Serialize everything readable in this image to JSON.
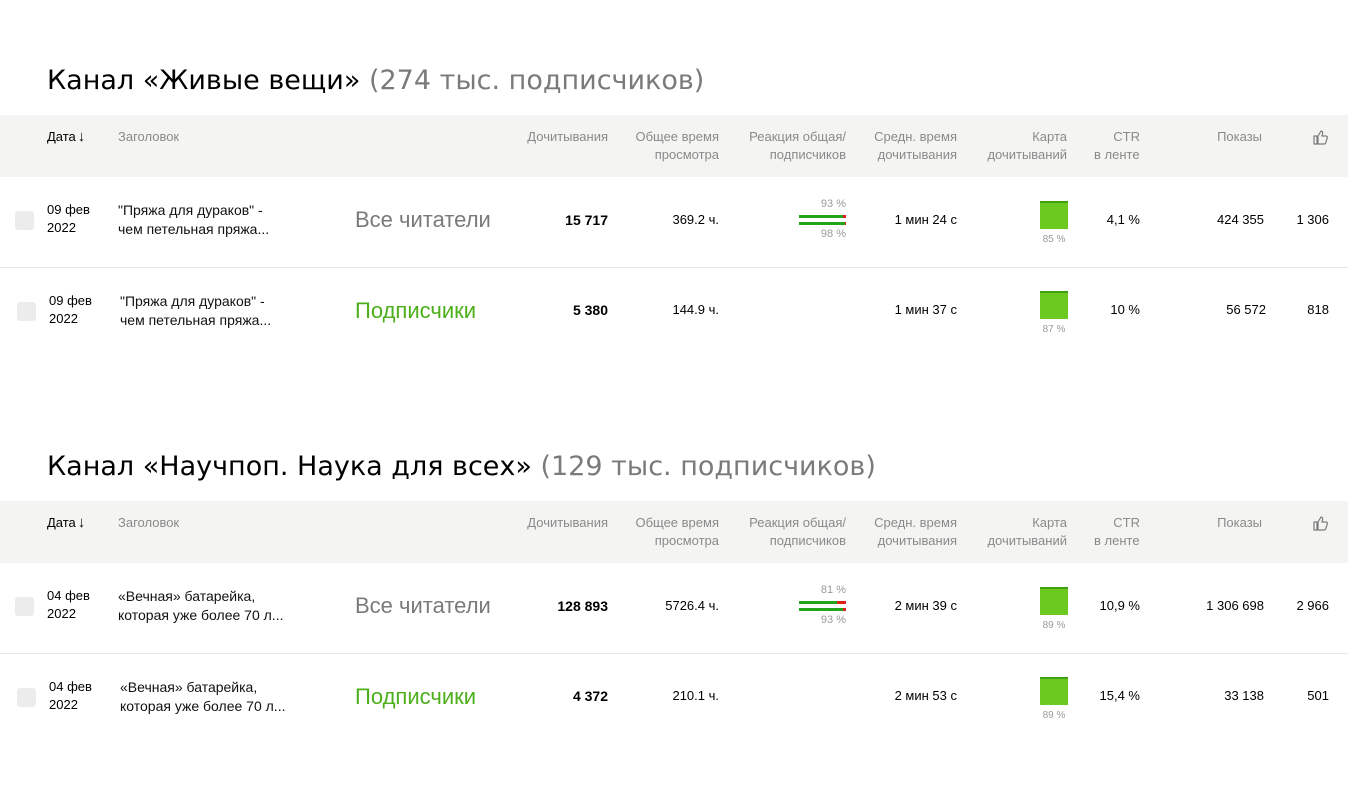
{
  "columns": {
    "date": "Дата",
    "date_sort_icon": "arrow-down-icon",
    "title": "Заголовок",
    "reads": "Дочитывания",
    "total_time_1": "Общее время",
    "total_time_2": "просмотра",
    "reaction_1": "Реакция общая/",
    "reaction_2": "подписчиков",
    "avg_time_1": "Средн. время",
    "avg_time_2": "дочитывания",
    "map_1": "Карта",
    "map_2": "дочитываний",
    "ctr_1": "CTR",
    "ctr_2": "в ленте",
    "views": "Показы",
    "likes_icon": "thumbs-up-icon"
  },
  "colors": {
    "accent_green": "#4caf1a",
    "bar_green": "#22a51a",
    "bar_red": "#e0211b",
    "map_green": "#6cc91f",
    "header_bg": "#f4f4f2"
  },
  "channels": [
    {
      "name": "Канал «Живые вещи»",
      "subscribers": "(274 тыс. подписчиков)",
      "rows": [
        {
          "date_1": "09 фев",
          "date_2": "2022",
          "title_1": "\"Пряжа для дураков\" -",
          "title_2": "чем петельная пряжа...",
          "audience": "Все читатели",
          "reads": "15 717",
          "total_time": "369.2 ч.",
          "reaction_top": "93 %",
          "reaction_bottom": "98 %",
          "reaction_top_value": 0.93,
          "reaction_bottom_value": 0.98,
          "avg_time": "1 мин 24 с",
          "map_pct": "85 %",
          "ctr": "4,1 %",
          "views": "424 355",
          "likes": "1 306"
        },
        {
          "date_1": "09 фев",
          "date_2": "2022",
          "title_1": "\"Пряжа для дураков\" -",
          "title_2": "чем петельная пряжа...",
          "audience": "Подписчики",
          "reads": "5 380",
          "total_time": "144.9 ч.",
          "avg_time": "1 мин 37 с",
          "map_pct": "87 %",
          "ctr": "10 %",
          "views": "56 572",
          "likes": "818"
        }
      ]
    },
    {
      "name": "Канал «Научпоп. Наука для всех»",
      "subscribers": "(129 тыс. подписчиков)",
      "rows": [
        {
          "date_1": "04 фев",
          "date_2": "2022",
          "title_1": "«Вечная» батарейка,",
          "title_2": "которая уже более 70 л...",
          "audience": "Все читатели",
          "reads": "128 893",
          "total_time": "5726.4 ч.",
          "reaction_top": "81 %",
          "reaction_bottom": "93 %",
          "reaction_top_value": 0.81,
          "reaction_bottom_value": 0.93,
          "avg_time": "2 мин 39 с",
          "map_pct": "89 %",
          "ctr": "10,9 %",
          "views": "1 306 698",
          "likes": "2 966"
        },
        {
          "date_1": "04 фев",
          "date_2": "2022",
          "title_1": "«Вечная» батарейка,",
          "title_2": "которая уже более 70 л...",
          "audience": "Подписчики",
          "reads": "4 372",
          "total_time": "210.1 ч.",
          "avg_time": "2 мин 53 с",
          "map_pct": "89 %",
          "ctr": "15,4 %",
          "views": "33 138",
          "likes": "501"
        }
      ]
    }
  ]
}
